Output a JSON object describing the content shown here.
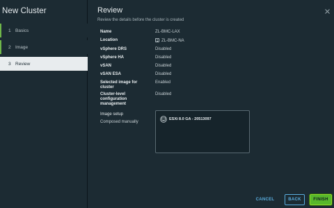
{
  "left_panel": {
    "title": "New Cluster",
    "steps": [
      {
        "num": "1",
        "label": "Basics",
        "state": "done"
      },
      {
        "num": "2",
        "label": "Image",
        "state": "done"
      },
      {
        "num": "3",
        "label": "Review",
        "state": "active"
      }
    ]
  },
  "review": {
    "title": "Review",
    "subtitle": "Review the details before the cluster is created",
    "rows": [
      {
        "key": "Name",
        "value": "ZL-BMC-LAX"
      },
      {
        "key": "Location",
        "value": "ZL-BMC-NA"
      },
      {
        "key": "vSphere DRS",
        "value": "Disabled"
      },
      {
        "key": "vSphere HA",
        "value": "Disabled"
      },
      {
        "key": "vSAN",
        "value": "Disabled"
      },
      {
        "key": "vSAN ESA",
        "value": "Disabled"
      },
      {
        "key": "Selected image for cluster",
        "value": "Enabled"
      },
      {
        "key": "Cluster-level configuration management",
        "value": "Disabled"
      }
    ],
    "image_setup_label": "Image setup",
    "image_setup_value": "Composed manually",
    "image_name": "ESXi 8.0 GA - 20513097"
  },
  "footer": {
    "cancel_label": "CANCEL",
    "back_label": "BACK",
    "finish_label": "FINISH"
  },
  "colors": {
    "accent_green": "#58b82c",
    "link_blue": "#5aaee0",
    "panel_bg": "#1c2b33"
  }
}
